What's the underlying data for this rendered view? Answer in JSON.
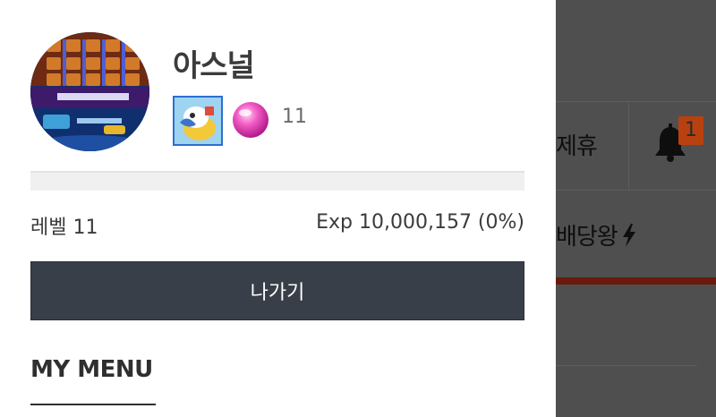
{
  "user": {
    "name": "아스널",
    "gem_count": "11",
    "level_label": "레벨 11",
    "exp_label": "Exp 10,000,157 (0%)",
    "exp_progress": 0
  },
  "actions": {
    "exit_label": "나가기"
  },
  "menu": {
    "title": "MY MENU"
  },
  "background_page": {
    "partner_text": "제휴",
    "notification_count": "1",
    "dividend_text": "배당왕"
  },
  "icons": {
    "avatar": "slot-machine-avatar",
    "badge": "cartoon-character-badge-icon",
    "gem": "pink-gem-icon",
    "bell": "bell-icon",
    "bolt": "lightning-bolt-icon"
  },
  "colors": {
    "button_bg": "#383f48",
    "backdrop": "#4f4f4f",
    "badge_accent": "#b9410f",
    "exp_track": "#f0f0f0"
  }
}
